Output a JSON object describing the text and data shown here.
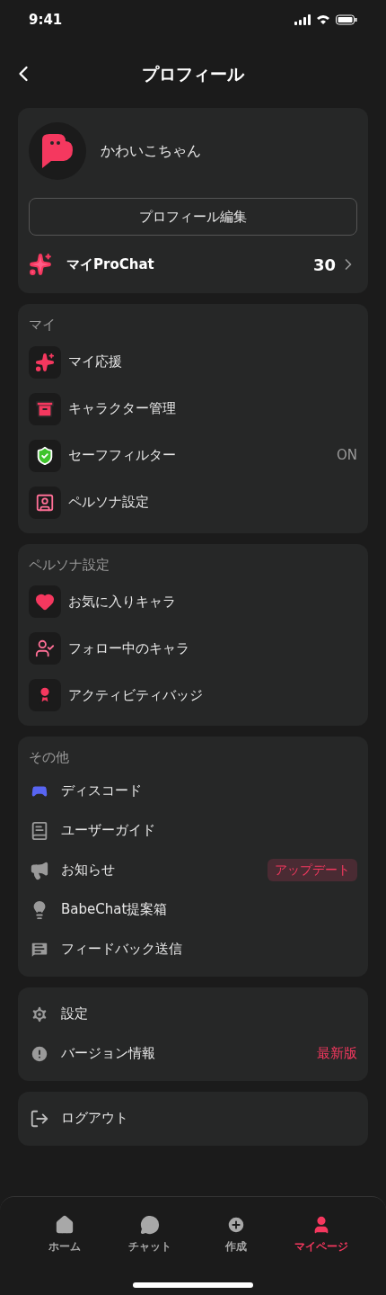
{
  "status_bar": {
    "time": "9:41"
  },
  "header": {
    "title": "プロフィール"
  },
  "profile": {
    "name": "かわいこちゃん",
    "edit_button": "プロフィール編集",
    "prochat": {
      "label": "マイProChat",
      "count": "30"
    }
  },
  "sections": [
    {
      "title": "マイ",
      "kind": "boxed",
      "items": [
        {
          "label": "マイ応援"
        },
        {
          "label": "キャラクター管理"
        },
        {
          "label": "セーフフィルター",
          "trailing": {
            "kind": "plain",
            "text": "ON"
          }
        },
        {
          "label": "ペルソナ設定"
        }
      ]
    },
    {
      "title": "ペルソナ設定",
      "kind": "boxed",
      "items": [
        {
          "label": "お気に入りキャラ"
        },
        {
          "label": "フォロー中のキャラ"
        },
        {
          "label": "アクティビティバッジ"
        }
      ]
    },
    {
      "title": "その他",
      "kind": "plain",
      "items": [
        {
          "label": "ディスコード"
        },
        {
          "label": "ユーザーガイド"
        },
        {
          "label": "お知らせ",
          "trailing": {
            "kind": "badge",
            "text": "アップデート"
          }
        },
        {
          "label": "BabeChat提案箱"
        },
        {
          "label": "フィードバック送信"
        }
      ]
    },
    {
      "kind": "plain",
      "items": [
        {
          "label": "設定"
        },
        {
          "label": "バージョン情報",
          "trailing": {
            "kind": "accent",
            "text": "最新版"
          }
        }
      ]
    },
    {
      "kind": "plain",
      "items": [
        {
          "label": "ログアウト"
        }
      ]
    }
  ],
  "tabs": [
    {
      "label": "ホーム",
      "selected": false
    },
    {
      "label": "チャット",
      "selected": false
    },
    {
      "label": "作成",
      "selected": false
    },
    {
      "label": "マイページ",
      "selected": true
    }
  ]
}
